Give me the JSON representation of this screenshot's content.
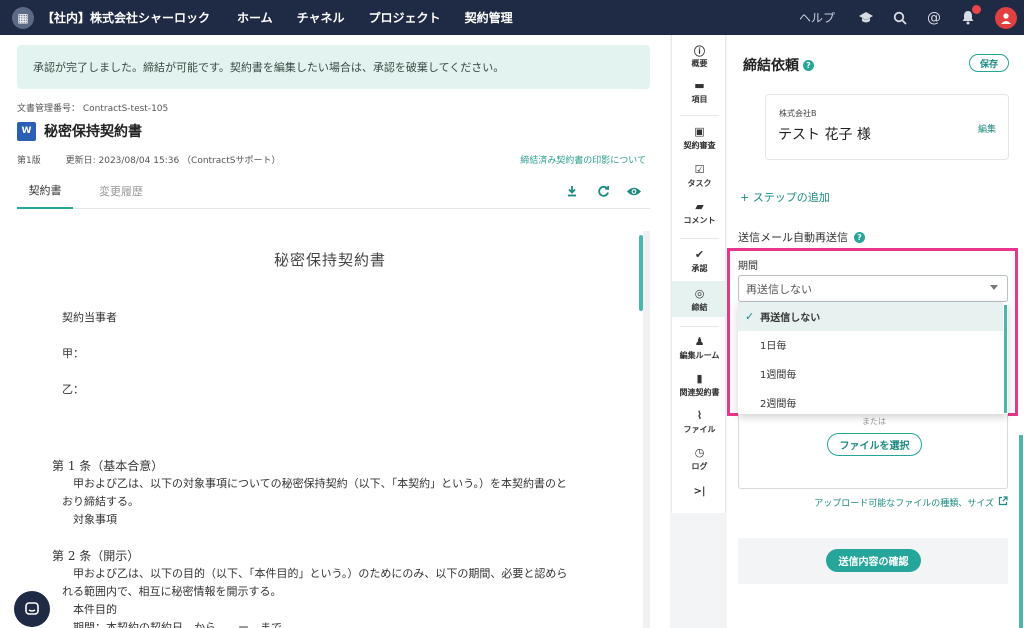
{
  "topbar": {
    "org_name": "【社内】株式会社シャーロック",
    "nav": [
      "ホーム",
      "チャネル",
      "プロジェクト",
      "契約管理"
    ],
    "help": "ヘルプ"
  },
  "main": {
    "notice": "承認が完了しました。締結が可能です。契約書を編集したい場合は、承認を破棄してください。",
    "doc_number": "文書管理番号： ContractS-test-105",
    "doc_title": "秘密保持契約書",
    "version": "第1版",
    "updated": "更新日: 2023/08/04 15:36 （ContractSサポート）",
    "seal_link": "締結済み契約書の印影について",
    "tabs": [
      "契約書",
      "変更履歴"
    ]
  },
  "paper": {
    "title": "秘密保持契約書",
    "lines": [
      "契約当事者",
      "甲：",
      "乙：",
      "第 1 条（基本合意）",
      "甲および乙は、以下の対象事項についての秘密保持契約（以下、「本契約」という。）を本契約書のと",
      "おり締結する。",
      "対象事項",
      "第 2 条（開示）",
      "甲および乙は、以下の目的（以下、「本件目的」という。）のためにのみ、以下の期間、必要と認めら",
      "れる範囲内で、相互に秘密情報を開示する。",
      "本件目的",
      "期間：本契約の契約日　から　　ー　まで"
    ]
  },
  "rail": {
    "items": [
      "概要",
      "項目",
      "契約審査",
      "タスク",
      "コメント",
      "承認",
      "締結",
      "編集ルーム",
      "関連契約書",
      "ファイル",
      "ログ"
    ],
    "collapse": ">|"
  },
  "panel": {
    "title": "締結依頼",
    "save": "保存",
    "signer_company": "株式会社B",
    "signer_name": "テスト 花子 様",
    "edit": "編集",
    "add_step": "+ ステップの追加",
    "resend_label": "送信メール自動再送信",
    "period_label": "期間",
    "select_value": "再送信しない",
    "options": [
      "再送信しない",
      "1日毎",
      "1週間毎",
      "2週間毎"
    ],
    "upload_or": "または",
    "file_button": "ファイルを選択",
    "upload_types": "アップロード可能なファイルの種類、サイズ",
    "confirm": "送信内容の確認"
  },
  "colors": {
    "accent": "#26a69a",
    "nav_bg": "#1f2a44",
    "highlight": "#e8378a"
  }
}
